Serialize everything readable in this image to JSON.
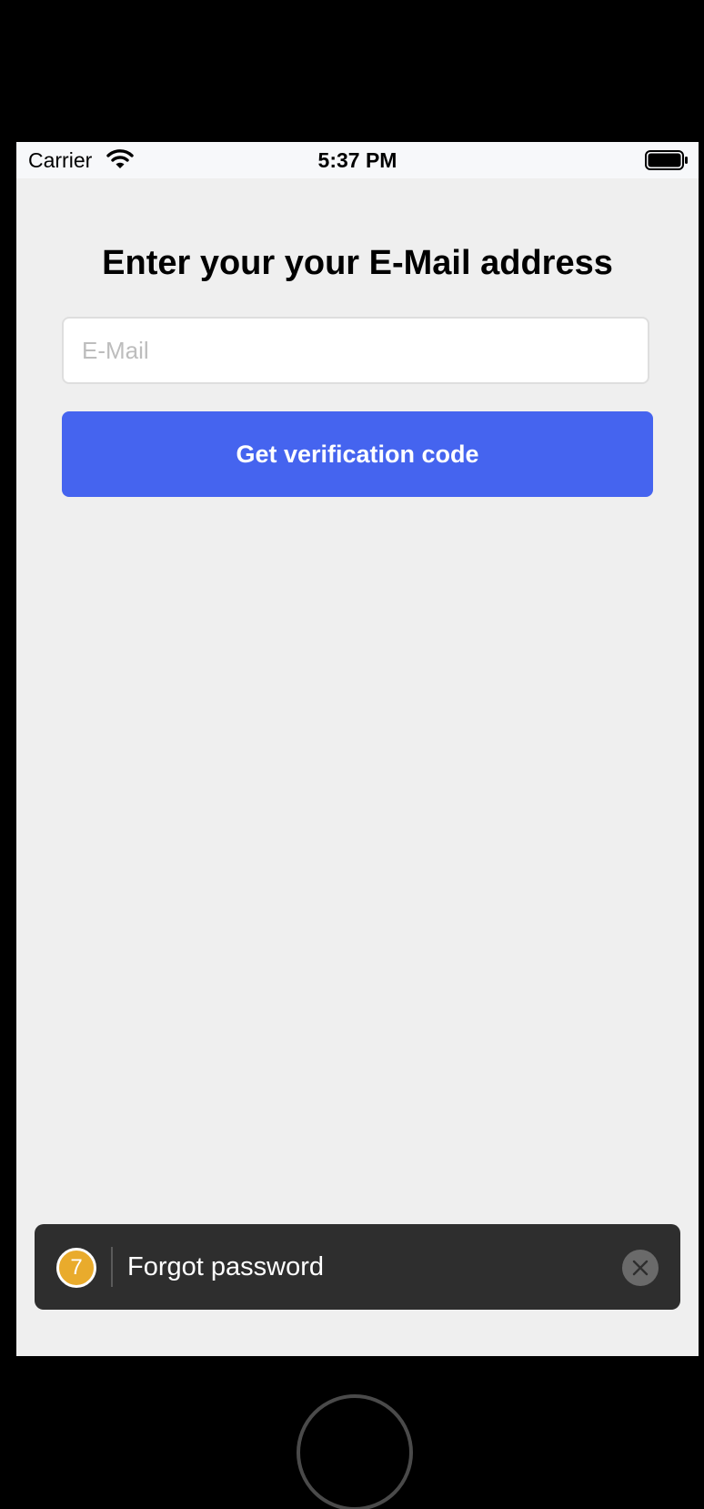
{
  "status_bar": {
    "carrier": "Carrier",
    "time": "5:37 PM",
    "wifi_icon": "wifi-icon",
    "battery_icon": "battery-full-icon"
  },
  "form": {
    "heading": "Enter your your E-Mail address",
    "email_placeholder": "E-Mail",
    "email_value": "",
    "submit_label": "Get verification code",
    "accent_color": "#4564ef"
  },
  "toast": {
    "step_number": "7",
    "label": "Forgot password",
    "badge_color": "#e9ab2c",
    "close_icon": "close-icon"
  },
  "device": {
    "home_button_icon": "home-button"
  }
}
